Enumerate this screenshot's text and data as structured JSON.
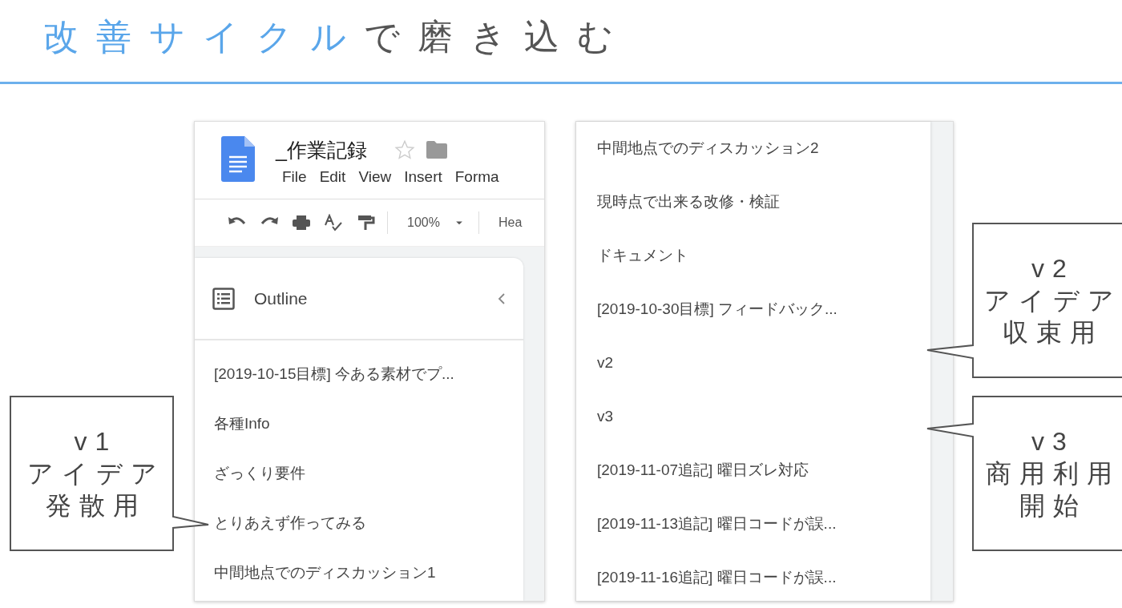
{
  "title": {
    "accent": "改善サイクル",
    "rest": "で磨き込む"
  },
  "doc": {
    "title": "_作業記録",
    "menu": [
      "File",
      "Edit",
      "View",
      "Insert",
      "Forma"
    ],
    "zoom": "100%",
    "style": "Hea",
    "outline": {
      "heading": "Outline",
      "items": [
        "[2019-10-15目標] 今ある素材でプ...",
        "各種Info",
        "ざっくり要件",
        "とりあえず作ってみる",
        "中間地点でのディスカッション1"
      ]
    }
  },
  "doc_continued": {
    "items": [
      "中間地点でのディスカッション2",
      "現時点で出来る改修・検証",
      "ドキュメント",
      "[2019-10-30目標] フィードバック...",
      "v2",
      "v3",
      "[2019-11-07追記] 曜日ズレ対応",
      "[2019-11-13追記] 曜日コードが誤...",
      "[2019-11-16追記] 曜日コードが誤..."
    ]
  },
  "callouts": [
    {
      "kind": "pointer_right",
      "lines": [
        "v1",
        "アイデア",
        "発散用"
      ]
    },
    {
      "kind": "pointer_left",
      "lines": [
        "v2",
        "アイデア",
        "収束用"
      ]
    },
    {
      "kind": "pointer_left",
      "lines": [
        "v3",
        "商用利用",
        "開始"
      ]
    }
  ]
}
